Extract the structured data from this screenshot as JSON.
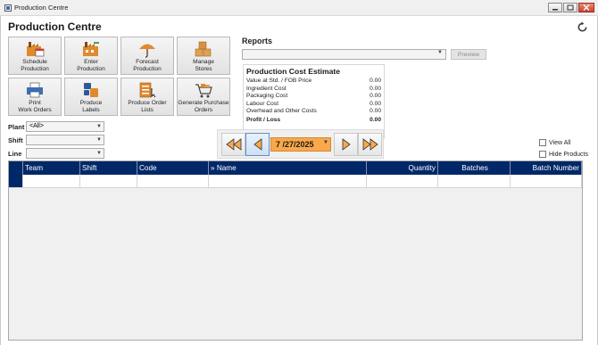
{
  "window": {
    "title": "Production Centre"
  },
  "page": {
    "title": "Production Centre"
  },
  "tiles": [
    {
      "label": "Schedule\nProduction",
      "icon": "factory-calendar-icon"
    },
    {
      "label": "Enter\nProduction",
      "icon": "factory-enter-icon"
    },
    {
      "label": "Forecast\nProduction",
      "icon": "umbrella-forecast-icon"
    },
    {
      "label": "Manage\nStores",
      "icon": "boxes-stores-icon"
    },
    {
      "label": "Print\nWork Orders",
      "icon": "printer-icon"
    },
    {
      "label": "Produce\nLabels",
      "icon": "labels-icon"
    },
    {
      "label": "Produce Order\nLists",
      "icon": "order-list-icon"
    },
    {
      "label": "Generate Purchase\nOrders",
      "icon": "shopping-cart-icon"
    }
  ],
  "filters": {
    "plant": {
      "label": "Plant",
      "value": "<All>"
    },
    "shift": {
      "label": "Shift",
      "value": ""
    },
    "line": {
      "label": "Line",
      "value": ""
    }
  },
  "reports": {
    "title": "Reports",
    "selected": "",
    "preview_label": "Preview"
  },
  "cost_estimate": {
    "title": "Production Cost Estimate",
    "rows": [
      {
        "label": "Value at Std. / FOB Price",
        "value": "0.00"
      },
      {
        "label": "Ingredient Cost",
        "value": "0.00"
      },
      {
        "label": "Packaging Cost",
        "value": "0.00"
      },
      {
        "label": "Labour Cost",
        "value": "0.00"
      },
      {
        "label": "Overhead and Other Costs",
        "value": "0.00"
      }
    ],
    "total": {
      "label": "Profit / Loss",
      "value": "0.00"
    }
  },
  "date_nav": {
    "date": "7 /27/2025"
  },
  "options": {
    "view_all": "View All",
    "hide_products": "Hide Products"
  },
  "grid": {
    "columns": [
      "Team",
      "Shift",
      "Code",
      "» Name",
      "Quantity",
      "Batches",
      "Batch Number"
    ]
  },
  "colors": {
    "grid_header": "#002868",
    "date_highlight": "#f9a84a"
  }
}
